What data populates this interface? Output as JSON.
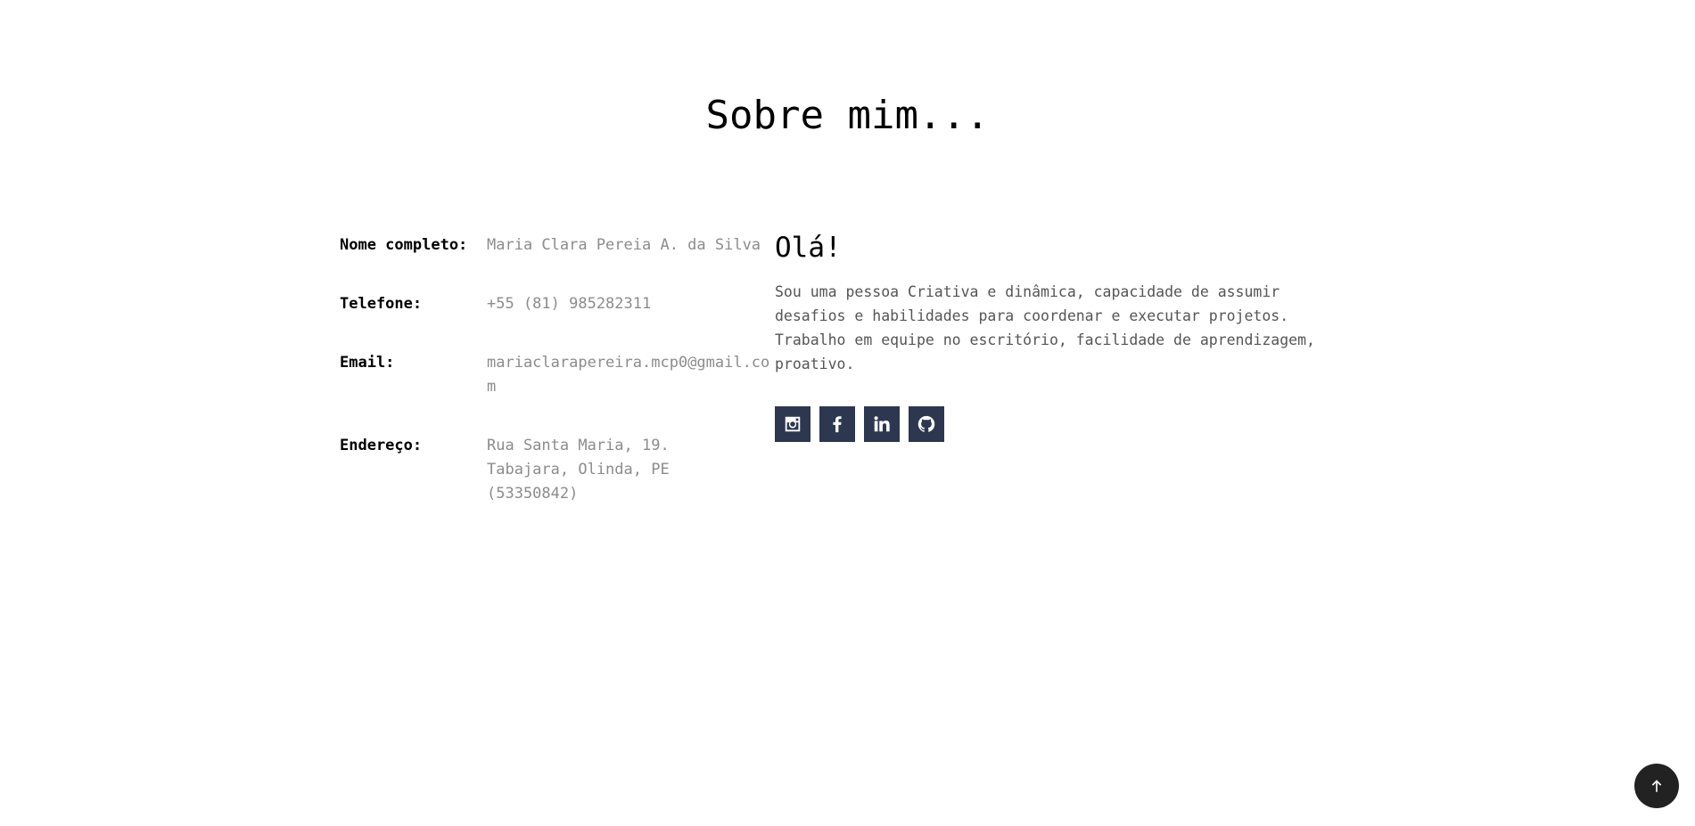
{
  "section": {
    "title": "Sobre mim..."
  },
  "info": [
    {
      "label": "Nome completo:",
      "value": "Maria Clara Pereia A. da Silva"
    },
    {
      "label": "Telefone:",
      "value": "+55 (81) 985282311"
    },
    {
      "label": "Email:",
      "value": "mariaclarapereira.mcp0@gmail.com"
    },
    {
      "label": "Endereço:",
      "value": "Rua Santa Maria, 19. Tabajara, Olinda, PE (53350842)"
    }
  ],
  "about": {
    "heading": "Olá!",
    "text": "Sou uma pessoa Criativa e dinâmica, capacidade de assumir desafios e habilidades para coordenar e executar projetos. Trabalho em equipe no escritório, facilidade de aprendizagem, proativo."
  },
  "socials": [
    {
      "icon": "instagram-icon"
    },
    {
      "icon": "facebook-icon"
    },
    {
      "icon": "linkedin-icon"
    },
    {
      "icon": "github-icon"
    }
  ],
  "colors": {
    "social_bg": "#2d3750",
    "back_to_top_bg": "#222222",
    "value_text": "#8c8c8c"
  },
  "back_to_top": {
    "icon": "arrow-up-icon"
  }
}
